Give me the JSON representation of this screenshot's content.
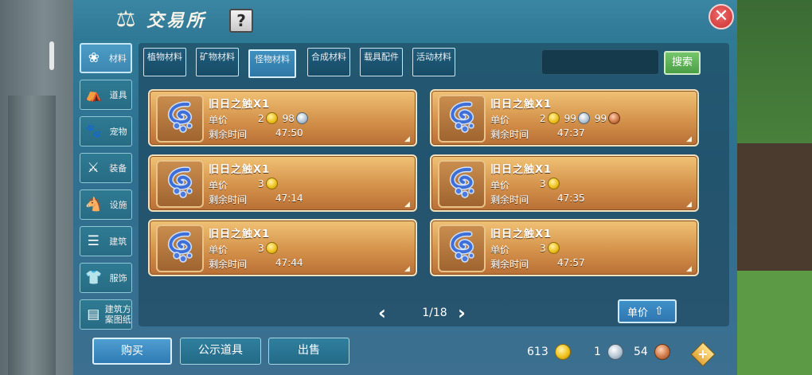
{
  "window": {
    "title": "交易所",
    "help_label": "?",
    "close_label": "✕"
  },
  "sidebar": {
    "items": [
      {
        "label": "材料",
        "icon": "material-icon",
        "glyph": "❀",
        "active": true
      },
      {
        "label": "道具",
        "icon": "prop-icon",
        "glyph": "⛺",
        "active": false
      },
      {
        "label": "宠物",
        "icon": "pet-paw-icon",
        "glyph": "🐾",
        "active": false
      },
      {
        "label": "装备",
        "icon": "equipment-icon",
        "glyph": "⚔",
        "active": false
      },
      {
        "label": "设施",
        "icon": "facility-icon",
        "glyph": "🐴",
        "active": false
      },
      {
        "label": "建筑",
        "icon": "building-icon",
        "glyph": "☰",
        "active": false
      },
      {
        "label": "服饰",
        "icon": "clothing-icon",
        "glyph": "👕",
        "active": false
      },
      {
        "label": "建筑方案图纸",
        "icon": "blueprint-icon",
        "glyph": "▤",
        "active": false
      }
    ]
  },
  "tabs": [
    {
      "label": "植物材料",
      "active": false
    },
    {
      "label": "矿物材料",
      "active": false
    },
    {
      "label": "怪物材料",
      "active": true
    },
    {
      "label": "合成材料",
      "active": false
    },
    {
      "label": "载具配件",
      "active": false
    },
    {
      "label": "活动材料",
      "active": false
    }
  ],
  "search": {
    "value": "",
    "placeholder": "",
    "button_label": "搜索"
  },
  "listing": {
    "price_label": "单价",
    "time_label": "剩余时间",
    "items": [
      {
        "name": "旧日之触X1",
        "gold": "2",
        "silver": "98",
        "copper": null,
        "time": "47:50"
      },
      {
        "name": "旧日之触X1",
        "gold": "2",
        "silver": "99",
        "copper": "99",
        "time": "47:37"
      },
      {
        "name": "旧日之触X1",
        "gold": "3",
        "silver": null,
        "copper": null,
        "time": "47:14"
      },
      {
        "name": "旧日之触X1",
        "gold": "3",
        "silver": null,
        "copper": null,
        "time": "47:35"
      },
      {
        "name": "旧日之触X1",
        "gold": "3",
        "silver": null,
        "copper": null,
        "time": "47:44"
      },
      {
        "name": "旧日之触X1",
        "gold": "3",
        "silver": null,
        "copper": null,
        "time": "47:57"
      }
    ]
  },
  "pagination": {
    "text": "1/18",
    "prev": "‹",
    "next": "›"
  },
  "sort": {
    "label": "单价",
    "arrow": "⇧"
  },
  "bottom": {
    "buy_label": "购买",
    "public_label": "公示道具",
    "sell_label": "出售"
  },
  "wallet": {
    "gold": "613",
    "silver": "1",
    "copper": "54",
    "add_label": "+"
  },
  "colors": {
    "panel": "#2f7e99",
    "card": "#d4924b",
    "gold_coin": "#f0c21f",
    "silver_coin": "#b6c6d4",
    "copper_coin": "#cf7a47",
    "search_button": "#4b9f45",
    "close_button": "#c72f2f"
  }
}
